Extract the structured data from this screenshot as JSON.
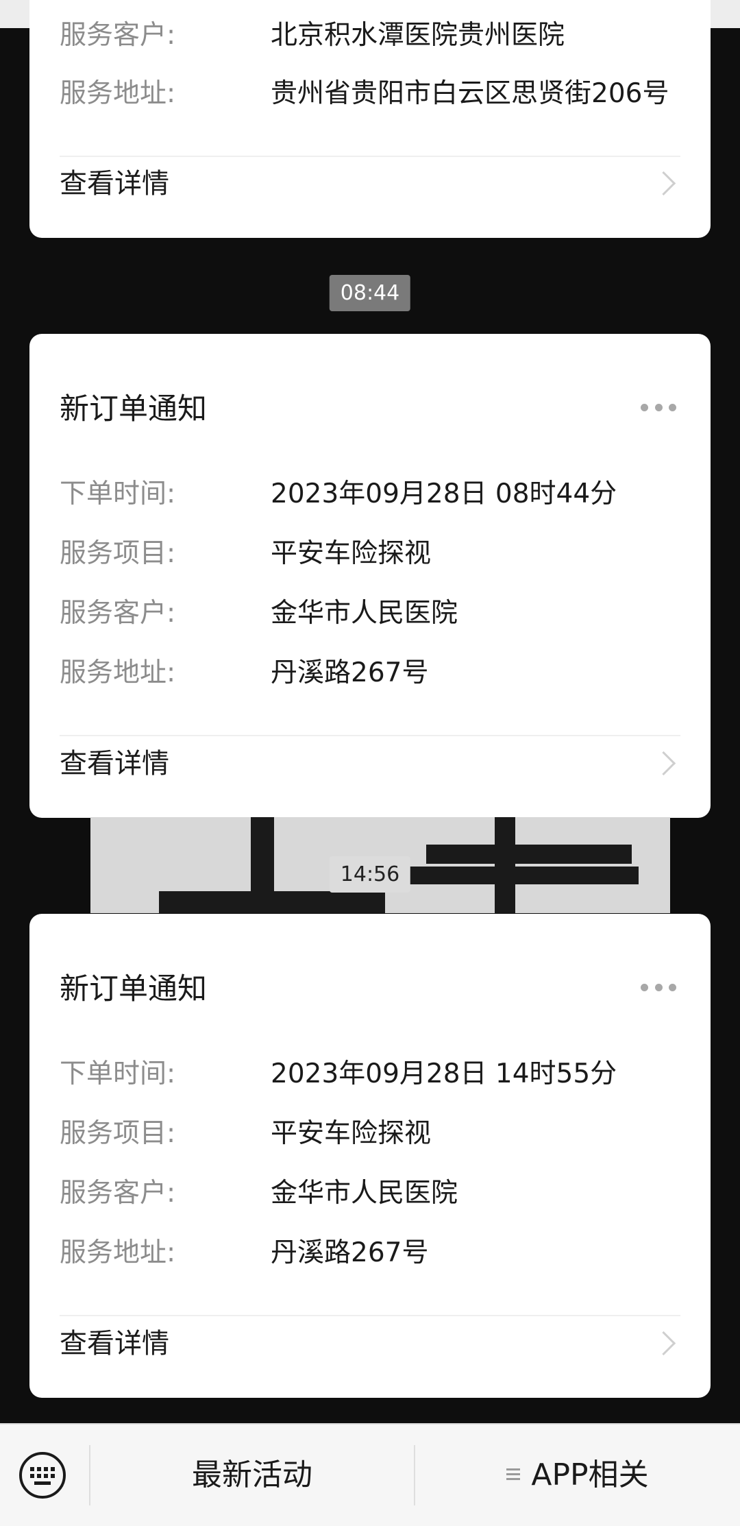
{
  "messages": [
    {
      "title": "",
      "rows": [
        {
          "label": "服务客户:",
          "value": "北京积水潭医院贵州医院"
        },
        {
          "label": "服务地址:",
          "value": "贵州省贵阳市白云区思贤街206号"
        }
      ],
      "detail_label": "查看详情"
    },
    {
      "time": "08:44",
      "title": "新订单通知",
      "rows": [
        {
          "label": "下单时间:",
          "value": "2023年09月28日 08时44分"
        },
        {
          "label": "服务项目:",
          "value": "平安车险探视"
        },
        {
          "label": "服务客户:",
          "value": "金华市人民医院"
        },
        {
          "label": "服务地址:",
          "value": "丹溪路267号"
        }
      ],
      "detail_label": "查看详情"
    },
    {
      "time": "14:56",
      "title": "新订单通知",
      "rows": [
        {
          "label": "下单时间:",
          "value": "2023年09月28日 14时55分"
        },
        {
          "label": "服务项目:",
          "value": "平安车险探视"
        },
        {
          "label": "服务客户:",
          "value": "金华市人民医院"
        },
        {
          "label": "服务地址:",
          "value": "丹溪路267号"
        }
      ],
      "detail_label": "查看详情"
    }
  ],
  "bottom_bar": {
    "keyboard_icon": "keyboard-icon",
    "menu_left": "最新活动",
    "menu_right": "APP相关",
    "menu_right_icon": "menu-lines-icon"
  },
  "colors": {
    "background": "#0e0e0e",
    "card": "#ffffff",
    "label": "#8c8c8c",
    "text": "#1a1a1a",
    "timestamp_bg_dark": "#7a7a7a"
  }
}
